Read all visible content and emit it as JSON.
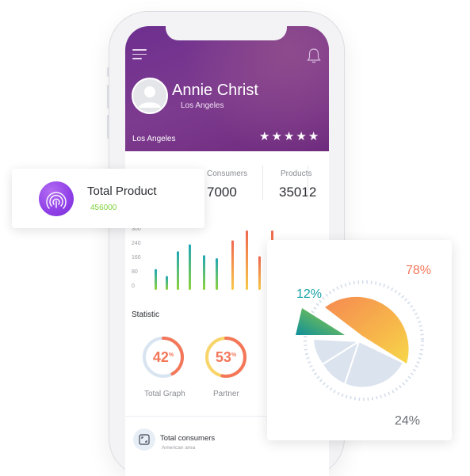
{
  "profile": {
    "name": "Annie Christ",
    "location_sub": "Los Angeles",
    "location_footer": "Los Angeles",
    "rating": 5,
    "stars": [
      "★",
      "★",
      "★",
      "★",
      "★"
    ]
  },
  "stats": [
    {
      "label": "Consumers",
      "value": "7000"
    },
    {
      "label": "Products",
      "value": "35012"
    }
  ],
  "bar_chart": {
    "y_ticks": [
      "300",
      "240",
      "160",
      "80",
      "0"
    ],
    "values": [
      105,
      70,
      195,
      230,
      175,
      160,
      250,
      300,
      170,
      300
    ]
  },
  "statistic": {
    "title": "Statistic",
    "rings": [
      {
        "value": "42",
        "unit": "%",
        "caption": "Total Graph",
        "percent": 42,
        "color": "#f4775a"
      },
      {
        "value": "53",
        "unit": "%",
        "caption": "Partner",
        "percent": 53,
        "color": "#f4775a"
      }
    ]
  },
  "list": {
    "title": "Total consumers",
    "subtitle": "American area"
  },
  "product_card": {
    "title": "Total Product",
    "value": "456000"
  },
  "chart_data": {
    "type": "pie",
    "slices": [
      {
        "label": "78%",
        "value": 78,
        "color": "#f59a4a"
      },
      {
        "label": "12%",
        "value": 12,
        "color": "#17a2a6"
      },
      {
        "label": "24%",
        "value": 24,
        "color": "#dbe3ee"
      }
    ]
  },
  "colors": {
    "header": "#7a3590",
    "accent_green": "#7fd23a",
    "accent_orange": "#f4775a",
    "teal": "#17a2a6"
  },
  "icons": {
    "menu": "menu-icon",
    "bell": "bell-icon",
    "avatar": "user-icon",
    "product": "signal-icon",
    "list": "expand-icon"
  }
}
